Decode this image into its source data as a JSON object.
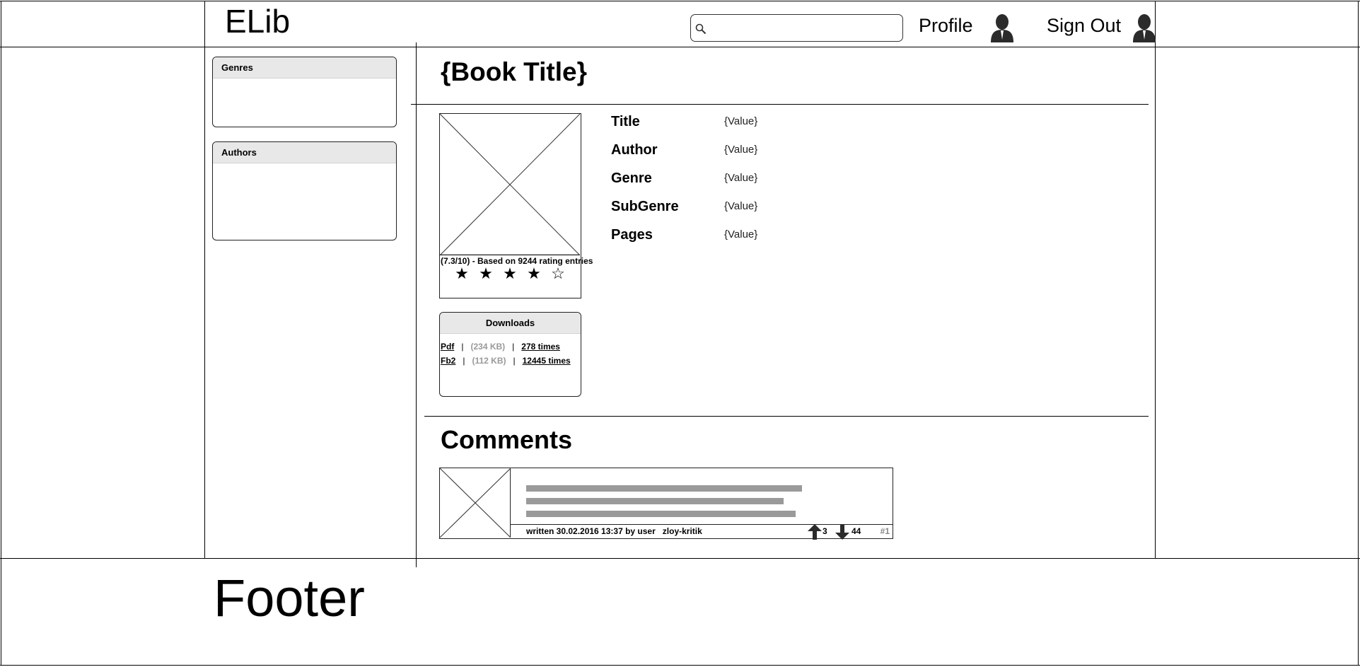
{
  "header": {
    "logo": "ELib",
    "search": {
      "placeholder": ""
    },
    "profile_label": "Profile",
    "signout_label": "Sign Out"
  },
  "sidebar": {
    "genres_title": "Genres",
    "authors_title": "Authors"
  },
  "book": {
    "title": "{Book Title}",
    "rating_text": "(7.3/10) - Based on 9244 rating entries",
    "stars": [
      "★",
      "★",
      "★",
      "★",
      "☆"
    ],
    "rating_stars": 4,
    "max_stars": 5,
    "properties": [
      {
        "label": "Title",
        "value": "{Value}"
      },
      {
        "label": "Author",
        "value": "{Value}"
      },
      {
        "label": "Genre",
        "value": "{Value}"
      },
      {
        "label": "SubGenre",
        "value": "{Value}"
      },
      {
        "label": "Pages",
        "value": "{Value}"
      }
    ]
  },
  "downloads": {
    "title": "Downloads",
    "separator": "|",
    "files": [
      {
        "format": "Pdf",
        "size": "(234 KB)",
        "count": "278 times"
      },
      {
        "format": "Fb2",
        "size": "(112 KB)",
        "count": "12445 times"
      }
    ]
  },
  "comments": {
    "title": "Comments",
    "items": [
      {
        "meta": "written 30.02.2016 13:37 by user",
        "user": "zloy-kritik",
        "upvotes": "3",
        "downvotes": "44",
        "number": "#1"
      }
    ]
  },
  "footer": {
    "label": "Footer"
  },
  "colors": {
    "panel_header": "#e8e8e8",
    "text_placeholder": "#9a9a9a"
  },
  "icons": [
    "search-icon",
    "profile-avatar-icon",
    "signout-avatar-icon",
    "image-placeholder-icon",
    "star-icon",
    "arrow-up-icon",
    "arrow-down-icon"
  ]
}
